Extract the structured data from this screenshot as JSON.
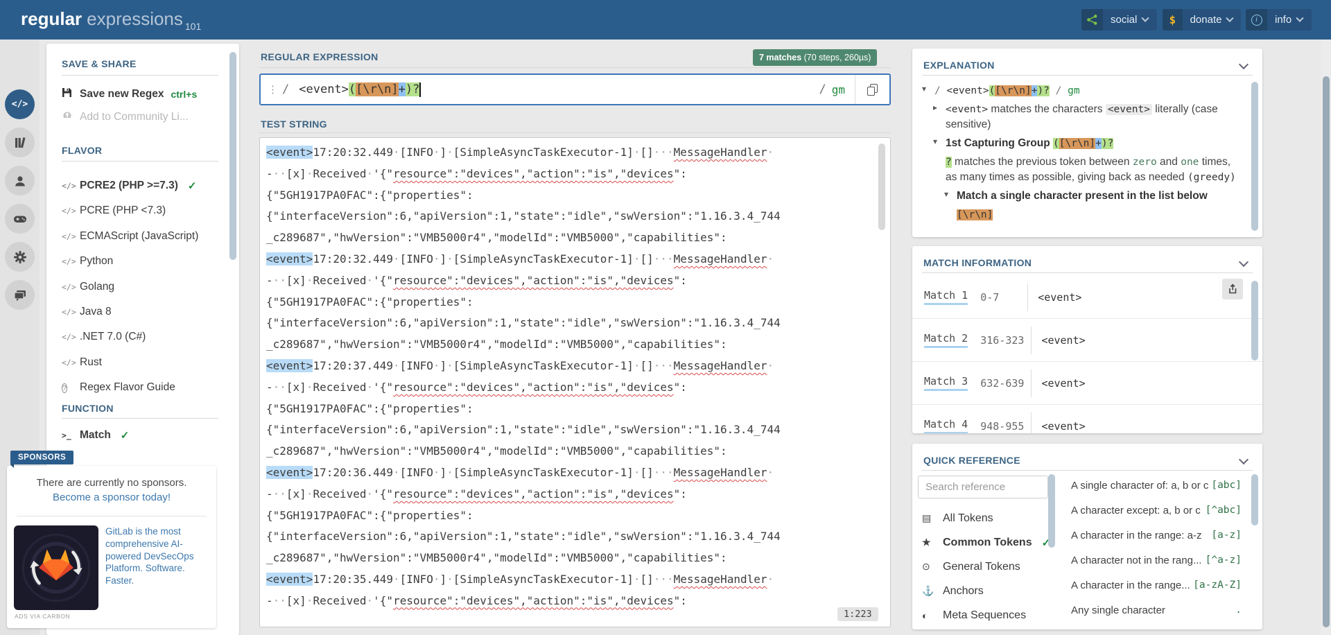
{
  "colors": {
    "header_blue": "#2b5d8c",
    "nav_dark": "#27517c",
    "nav_darker": "#224668",
    "accent_green": "#1f8a3d",
    "badge_green": "#4f8870",
    "link_blue": "#3d78ad",
    "hl_green": "#b5e08c",
    "hl_orange": "#d7975a",
    "hl_blue": "#8fc0f2",
    "match_blue": "#b8dbf8",
    "error_red": "#d84a4a",
    "title_blue": "#3d6484"
  },
  "header": {
    "logo": {
      "part1": "regular",
      "part2": "expressions",
      "sub": "101"
    },
    "nav_buttons": [
      {
        "label": "social",
        "icon": "share-nodes-icon"
      },
      {
        "label": "donate",
        "icon": "dollar-icon"
      },
      {
        "label": "info",
        "icon": "info-circle-icon"
      }
    ]
  },
  "rail": {
    "items": [
      {
        "name": "regex-editor",
        "icon": "code-icon",
        "active": true
      },
      {
        "name": "library",
        "icon": "library-icon",
        "active": false
      },
      {
        "name": "account",
        "icon": "user-icon",
        "active": false
      },
      {
        "name": "playground",
        "icon": "gamepad-icon",
        "active": false
      },
      {
        "name": "settings",
        "icon": "gear-icon",
        "active": false
      },
      {
        "name": "feedback",
        "icon": "chat-icon",
        "active": false
      }
    ]
  },
  "sidebar": {
    "save_share_title": "SAVE & SHARE",
    "save_item": {
      "label": "Save new Regex",
      "shortcut": "ctrl+s",
      "icon": "floppy-icon"
    },
    "community_item": {
      "label": "Add to Community Li...",
      "icon": "upload-icon"
    },
    "flavor_title": "FLAVOR",
    "flavors": [
      {
        "label": "PCRE2 (PHP >=7.3)",
        "icon": "code",
        "active": true
      },
      {
        "label": "PCRE (PHP <7.3)",
        "icon": "code",
        "active": false
      },
      {
        "label": "ECMAScript (JavaScript)",
        "icon": "code",
        "active": false
      },
      {
        "label": "Python",
        "icon": "code",
        "active": false
      },
      {
        "label": "Golang",
        "icon": "code",
        "active": false
      },
      {
        "label": "Java 8",
        "icon": "code",
        "active": false
      },
      {
        "label": ".NET 7.0 (C#)",
        "icon": "code",
        "active": false
      },
      {
        "label": "Rust",
        "icon": "code",
        "active": false
      },
      {
        "label": "Regex Flavor Guide",
        "icon": "question",
        "active": false
      }
    ],
    "function_title": "FUNCTION",
    "functions": [
      {
        "label": "Match",
        "icon": "terminal",
        "active": true
      }
    ]
  },
  "sponsors": {
    "badge": "SPONSORS",
    "empty_text": "There are currently no sponsors.",
    "cta": "Become a sponsor today!",
    "ad_text": "GitLab is the most comprehensive AI-powered DevSecOps Platform. Software. Faster.",
    "ad_caption": "ADS VIA CARBON",
    "ad_logo": "gitlab-logo"
  },
  "editor": {
    "regex_title": "REGULAR EXPRESSION",
    "match_badge_bold": "7 matches",
    "match_badge_rest": " (70 steps, 260µs)",
    "delimiter": "/",
    "regex_parts": [
      {
        "t": "<event>",
        "c": "plain"
      },
      {
        "t": "(",
        "c": "g"
      },
      {
        "t": "[\\r\\n]",
        "c": "o"
      },
      {
        "t": "+",
        "c": "b"
      },
      {
        "t": ")",
        "c": "g"
      },
      {
        "t": "?",
        "c": "g"
      }
    ],
    "flags": "gm",
    "test_title": "TEST STRING",
    "position_indicator": "1:223",
    "blocks": [
      "17:20:32.449",
      "17:20:32.449",
      "17:20:37.449",
      "17:20:36.449",
      "17:20:35.449"
    ],
    "block_lines": [
      [
        {
          "t": "<event>",
          "c": "hl"
        },
        {
          "t": "{ts}·[INFO·]·[SimpleAsyncTaskExecutor-1]·[]···",
          "c": ""
        },
        {
          "t": "MessageHandler",
          "c": "sp"
        },
        {
          "t": "·",
          "c": ""
        }
      ],
      [
        {
          "t": "-··[x]·Received·'{\"",
          "c": ""
        },
        {
          "t": "resource\":\"devices\",\"action\":\"is\",\"devices",
          "c": "sp"
        },
        {
          "t": "\":",
          "c": ""
        }
      ],
      [
        {
          "t": "{\"5GH1917PA0FAC\":{\"properties\":",
          "c": ""
        }
      ],
      [
        {
          "t": "{\"interfaceVersion\":6,\"apiVersion\":1,\"state\":\"idle\",\"swVersion\":\"1.16.3.4_744",
          "c": ""
        }
      ],
      [
        {
          "t": "_c289687\",\"hwVersion\":\"VMB5000r4\",\"modelId\":\"VMB5000\",\"capabilities\":",
          "c": ""
        }
      ]
    ],
    "visible_line_count": 22
  },
  "explanation": {
    "title": "EXPLANATION",
    "rows": [
      {
        "indent": 0,
        "caret": "down",
        "segs": [
          {
            "t": "/ ",
            "c": "code dim"
          },
          {
            "t": "<event>",
            "c": "code"
          },
          {
            "t": "(",
            "c": "code g"
          },
          {
            "t": "[\\r\\n]",
            "c": "code o"
          },
          {
            "t": "+",
            "c": "code bl"
          },
          {
            "t": ")",
            "c": "code g"
          },
          {
            "t": "?",
            "c": "code g"
          },
          {
            "t": " / ",
            "c": "code dim"
          },
          {
            "t": "gm",
            "c": "code green"
          }
        ]
      },
      {
        "indent": 1,
        "caret": "right",
        "segs": [
          {
            "t": "<event>",
            "c": "code"
          },
          {
            "t": " matches the characters ",
            "c": ""
          },
          {
            "t": "<event>",
            "c": "code codebg"
          },
          {
            "t": " literally (case sensitive)",
            "c": ""
          }
        ]
      },
      {
        "indent": 1,
        "caret": "down",
        "segs": [
          {
            "t": "1st Capturing Group ",
            "c": "b"
          },
          {
            "t": "(",
            "c": "code g"
          },
          {
            "t": "[\\r\\n]",
            "c": "code o"
          },
          {
            "t": "+",
            "c": "code bl"
          },
          {
            "t": ")",
            "c": "code g"
          },
          {
            "t": "?",
            "c": "code g"
          }
        ]
      },
      {
        "indent": 1,
        "caret": "none",
        "segs": [
          {
            "t": "?",
            "c": "code g"
          },
          {
            "t": " matches the previous token between ",
            "c": ""
          },
          {
            "t": "zero",
            "c": "code green2"
          },
          {
            "t": " and ",
            "c": ""
          },
          {
            "t": "one",
            "c": "code green2"
          },
          {
            "t": " times, as many times as possible, giving back as needed ",
            "c": ""
          },
          {
            "t": "(greedy)",
            "c": "code"
          }
        ]
      },
      {
        "indent": 2,
        "caret": "down",
        "segs": [
          {
            "t": "Match a single character present in the list below",
            "c": "b"
          }
        ]
      },
      {
        "indent": 2,
        "caret": "none",
        "segs": [
          {
            "t": "[\\r\\n]",
            "c": "code o"
          }
        ]
      }
    ]
  },
  "match_info": {
    "title": "MATCH INFORMATION",
    "export_icon": "export-icon",
    "matches": [
      {
        "label": "Match 1",
        "range": "0-7",
        "value": "<event>"
      },
      {
        "label": "Match 2",
        "range": "316-323",
        "value": "<event>"
      },
      {
        "label": "Match 3",
        "range": "632-639",
        "value": "<event>"
      },
      {
        "label": "Match 4",
        "range": "948-955",
        "value": "<event>"
      }
    ]
  },
  "quick_reference": {
    "title": "QUICK REFERENCE",
    "search_placeholder": "Search reference",
    "categories": [
      {
        "label": "All Tokens",
        "icon": "archive-icon",
        "active": false
      },
      {
        "label": "Common Tokens",
        "icon": "star-icon",
        "active": true
      },
      {
        "label": "General Tokens",
        "icon": "circle-dot-icon",
        "active": false
      },
      {
        "label": "Anchors",
        "icon": "anchor-icon",
        "active": false
      },
      {
        "label": "Meta Sequences",
        "icon": "meta-icon",
        "active": false
      }
    ],
    "tokens": [
      {
        "desc": "A single character of: a, b or c",
        "code": "[abc]"
      },
      {
        "desc": "A character except: a, b or c",
        "code": "[^abc]"
      },
      {
        "desc": "A character in the range: a-z",
        "code": "[a-z]"
      },
      {
        "desc": "A character not in the rang...",
        "code": "[^a-z]"
      },
      {
        "desc": "A character in the range...",
        "code": "[a-zA-Z]"
      },
      {
        "desc": "Any single character",
        "code": "."
      }
    ]
  }
}
